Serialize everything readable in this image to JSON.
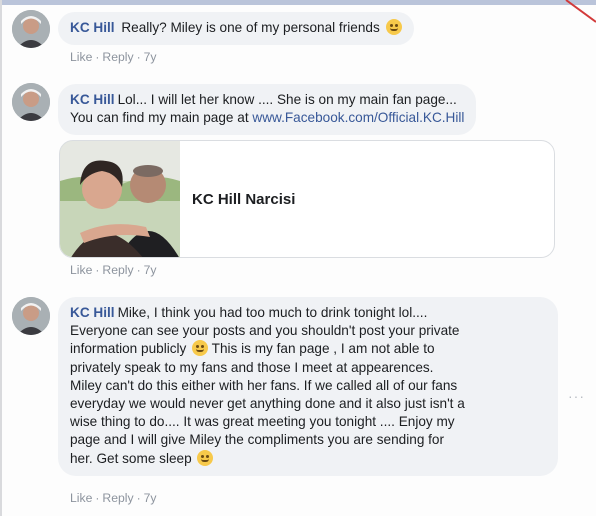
{
  "comments": [
    {
      "author": "KC Hill",
      "text": "Really? Miley is one of my personal friends",
      "emoji": "smile-emoji",
      "actions": {
        "like": "Like",
        "reply": "Reply",
        "time": "7y"
      }
    },
    {
      "author": "KC Hill",
      "text_line1": "Lol... I will let her know .... She is on my main fan page...",
      "text_line2": "You can find my main page at",
      "link": "www.Facebook.com/Official.KC.Hill",
      "actions": {
        "like": "Like",
        "reply": "Reply",
        "time": "7y"
      },
      "card": {
        "title": "KC Hill Narcisi"
      }
    },
    {
      "author": "KC Hill",
      "text_a": "Mike, I think you had too much to drink tonight lol....\nEveryone can see your posts and you shouldn't post your private\ninformation publicly",
      "text_b": "This is my fan page , I am not able to\nprivately speak to my fans and those I meet at appearences.\nMiley can't do this either with her fans. If we called all of our fans\neveryday we would never get anything done and it also just isn't a\nwise thing to do.... It was great meeting you tonight .... Enjoy my\npage and I will give Miley the compliments you are sending for\nher. Get some sleep",
      "actions": {
        "like": "Like",
        "reply": "Reply",
        "time": "7y"
      }
    }
  ],
  "more_options_label": "···",
  "colors": {
    "link": "#385898",
    "bubble": "#f0f2f5",
    "meta": "#8d949e"
  }
}
